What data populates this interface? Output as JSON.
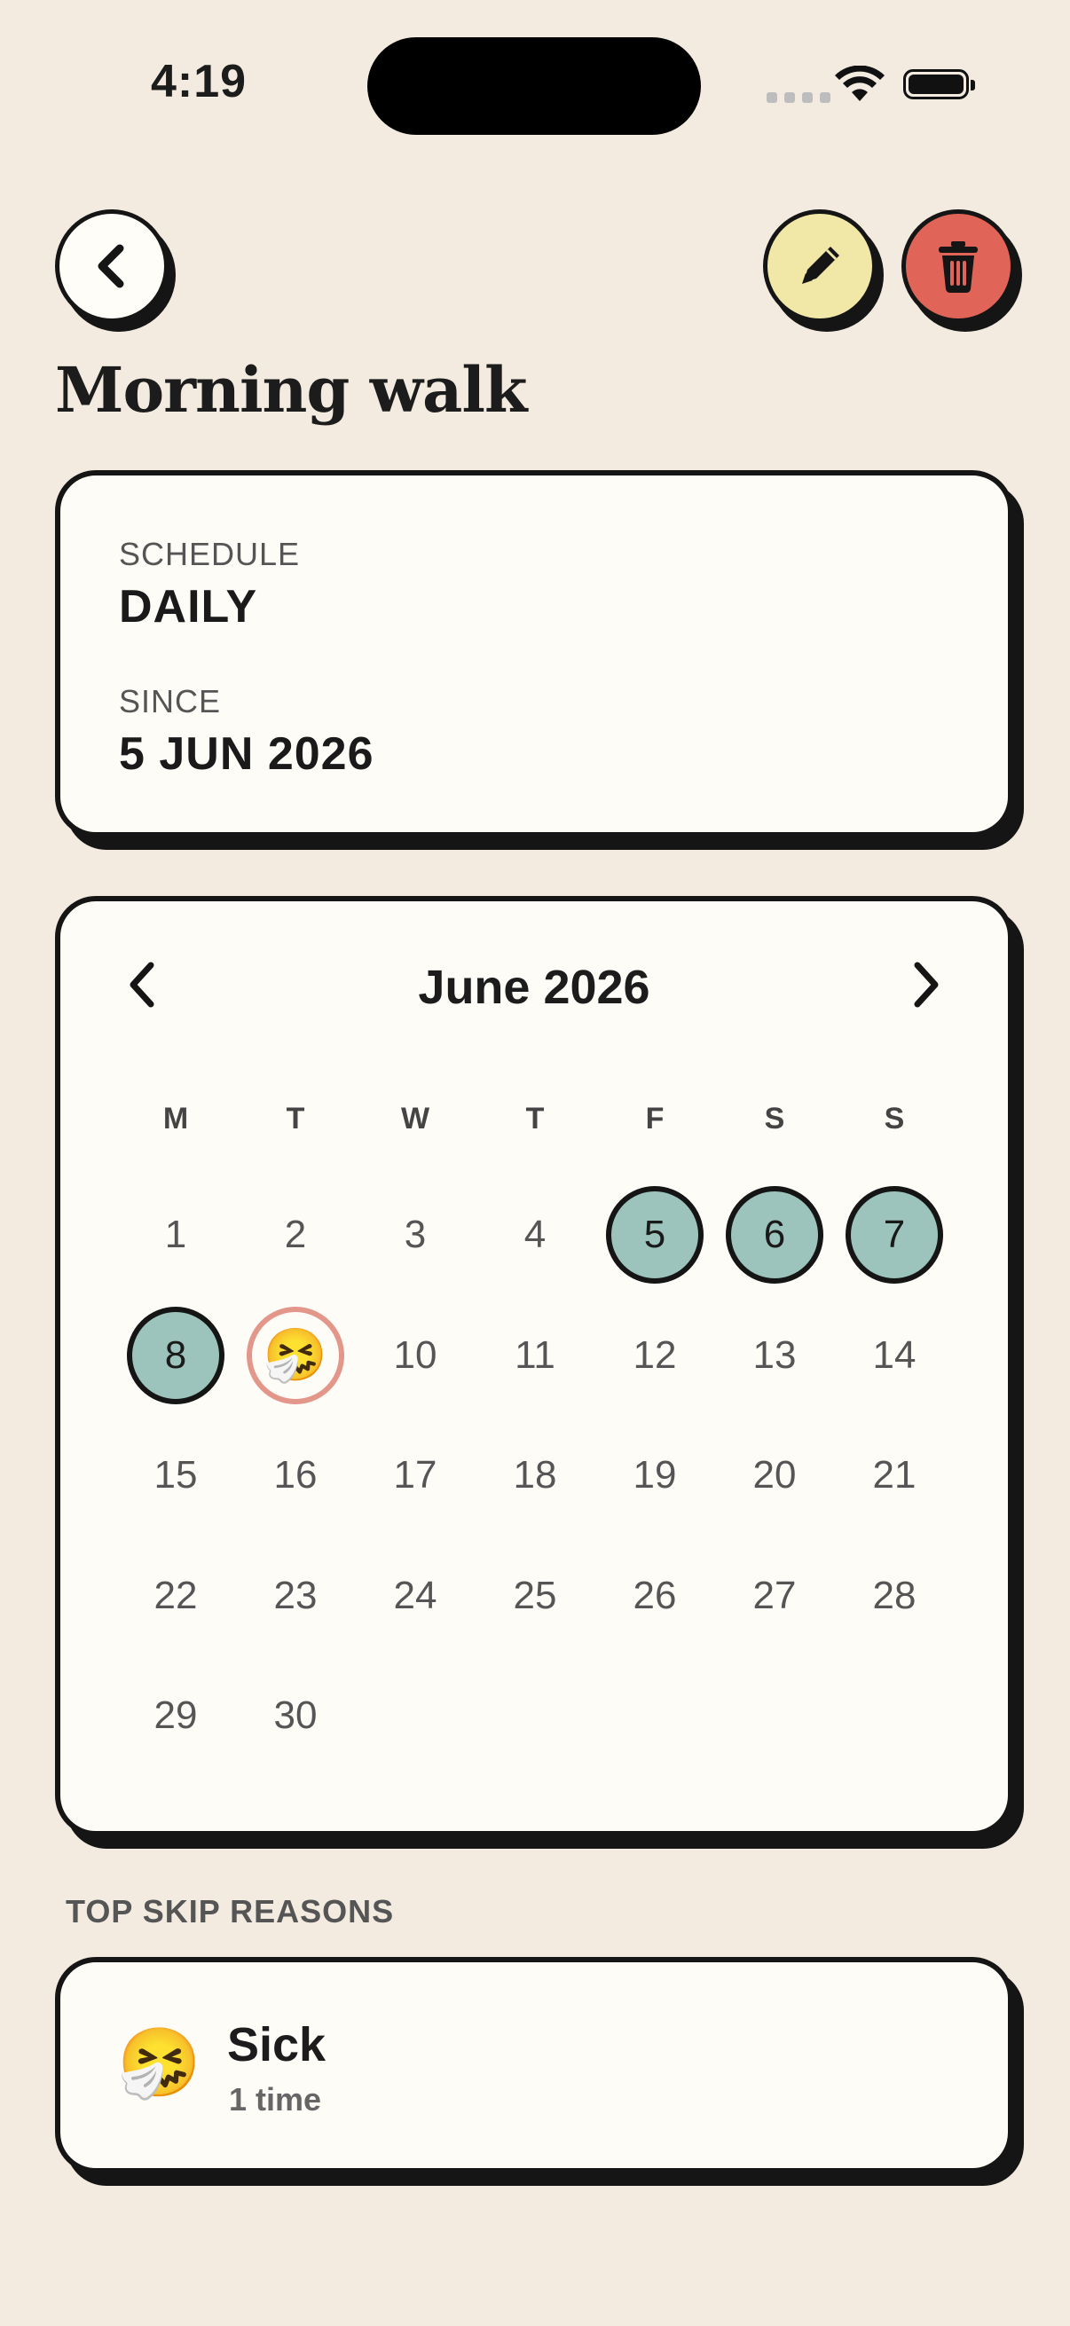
{
  "status_bar": {
    "time": "4:19"
  },
  "header": {
    "back_icon": "chevron-left-icon",
    "edit_icon": "pencil-icon",
    "delete_icon": "trash-icon",
    "title": "Morning walk"
  },
  "schedule": {
    "schedule_label": "SCHEDULE",
    "schedule_value": "DAILY",
    "since_label": "SINCE",
    "since_value": "5 JUN 2026"
  },
  "calendar": {
    "month_label": "June 2026",
    "weekdays": [
      "M",
      "T",
      "W",
      "T",
      "F",
      "S",
      "S"
    ],
    "first_weekday_index": 0,
    "days_in_month": 30,
    "completed_days": [
      5,
      6,
      7,
      8
    ],
    "skipped_days": [
      {
        "day": 9,
        "emoji": "🤧"
      }
    ]
  },
  "skip_reasons": {
    "section_label": "TOP SKIP REASONS",
    "items": [
      {
        "emoji": "🤧",
        "name": "Sick",
        "count": "1 time"
      }
    ]
  },
  "colors": {
    "background": "#f3ebdf",
    "card": "#fefcf7",
    "completed": "#9dc4bc",
    "skipped_ring": "#e3968a",
    "edit_button": "#f1e7a6",
    "delete_button": "#e06457"
  }
}
